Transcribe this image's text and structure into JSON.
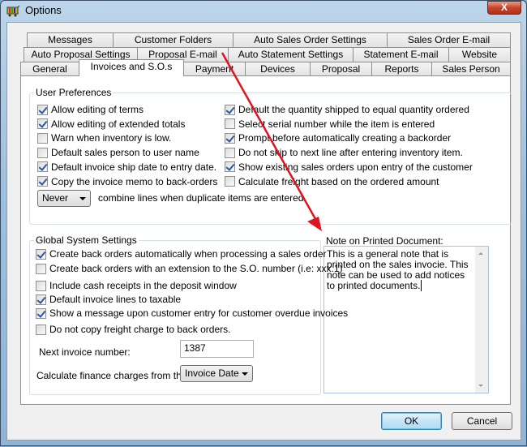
{
  "window": {
    "title": "Options",
    "close_label": "X"
  },
  "tabs": {
    "row1": [
      "Messages",
      "Customer Folders",
      "Auto Sales Order Settings",
      "Sales Order E-mail"
    ],
    "row2": [
      "Auto Proposal Settings",
      "Proposal E-mail",
      "Auto Statement Settings",
      "Statement E-mail",
      "Website"
    ],
    "row3": [
      "General",
      "Invoices and S.O.s",
      "Payment",
      "Devices",
      "Proposal",
      "Reports",
      "Sales Person"
    ],
    "active": "Invoices and S.O.s"
  },
  "user_preferences": {
    "title": "User Preferences",
    "left": [
      {
        "label": "Allow editing of terms",
        "checked": true
      },
      {
        "label": "Allow editing of extended totals",
        "checked": true
      },
      {
        "label": "Warn when inventory is low.",
        "checked": false
      },
      {
        "label": "Default sales person to user name",
        "checked": false
      },
      {
        "label": "Default invoice ship date to entry date.",
        "checked": true
      },
      {
        "label": "Copy the invoice memo to back-orders",
        "checked": true
      }
    ],
    "right": [
      {
        "label": "Default the quantity shipped to equal quantity ordered",
        "checked": true
      },
      {
        "label": "Select serial number while the item is entered",
        "checked": false
      },
      {
        "label": "Prompt before automatically creating a backorder",
        "checked": true
      },
      {
        "label": "Do not skip to next line after entering inventory item.",
        "checked": false
      },
      {
        "label": "Show existing sales orders upon entry of the customer",
        "checked": true
      },
      {
        "label": "Calculate freight based on the ordered amount",
        "checked": false
      }
    ],
    "combine_select": "Never",
    "combine_label": "combine lines when duplicate items are entered"
  },
  "global_settings": {
    "title": "Global System Settings",
    "items": [
      {
        "label": "Create back orders automatically when processing a sales order",
        "checked": true
      },
      {
        "label": "Create back orders with an extension to the S.O. number (i.e: xxx.1)",
        "checked": false
      },
      {
        "label": "Include cash receipts in the deposit window",
        "checked": false
      },
      {
        "label": "Default invoice lines to taxable",
        "checked": true
      },
      {
        "label": "Show a message upon customer entry for customer overdue invoices",
        "checked": true
      },
      {
        "label": "Do not copy freight charge to back orders.",
        "checked": false
      }
    ],
    "next_invoice_label": "Next invoice number:",
    "next_invoice_value": "1387",
    "finance_label": "Calculate finance charges from the",
    "finance_select": "Invoice Date"
  },
  "note": {
    "label": "Note on Printed Document:",
    "text": "This is a general note that is printed on the sales invocie.   This note can be used to add notices to printed documents."
  },
  "buttons": {
    "ok": "OK",
    "cancel": "Cancel"
  },
  "annotation": {
    "arrow_color": "#e0141e"
  }
}
